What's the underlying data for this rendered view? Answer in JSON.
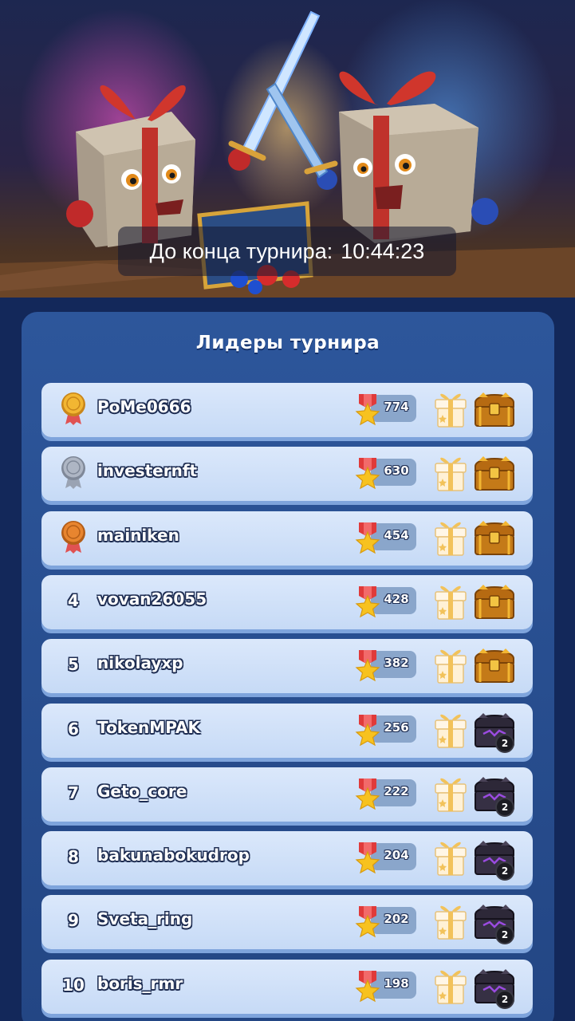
{
  "banner": {
    "timer_label": "До конца турнира:",
    "timer_value": "10:44:23"
  },
  "leaderboard": {
    "title": "Лидеры турнира",
    "rows": [
      {
        "rank": "1",
        "medal": "gold",
        "name": "PoMe0666",
        "score": "774",
        "chest": "gold",
        "chest_count": ""
      },
      {
        "rank": "2",
        "medal": "silver",
        "name": "investernft",
        "score": "630",
        "chest": "gold",
        "chest_count": ""
      },
      {
        "rank": "3",
        "medal": "bronze",
        "name": "mainiken",
        "score": "454",
        "chest": "gold",
        "chest_count": ""
      },
      {
        "rank": "4",
        "medal": "",
        "name": "vovan26055",
        "score": "428",
        "chest": "gold",
        "chest_count": ""
      },
      {
        "rank": "5",
        "medal": "",
        "name": "nikolayxp",
        "score": "382",
        "chest": "gold",
        "chest_count": ""
      },
      {
        "rank": "6",
        "medal": "",
        "name": "TokenMPAK",
        "score": "256",
        "chest": "dark",
        "chest_count": "2"
      },
      {
        "rank": "7",
        "medal": "",
        "name": "Geto_core",
        "score": "222",
        "chest": "dark",
        "chest_count": "2"
      },
      {
        "rank": "8",
        "medal": "",
        "name": "bakunabokudrop",
        "score": "204",
        "chest": "dark",
        "chest_count": "2"
      },
      {
        "rank": "9",
        "medal": "",
        "name": "Sveta_ring",
        "score": "202",
        "chest": "dark",
        "chest_count": "2"
      },
      {
        "rank": "10",
        "medal": "",
        "name": "boris_rmr",
        "score": "198",
        "chest": "dark",
        "chest_count": "2"
      }
    ]
  },
  "colors": {
    "background": "#13285a",
    "panel": "#2a5193",
    "row": "#d3e3f8",
    "gold_medal": "#f2b632",
    "silver_medal": "#aeb6c4",
    "bronze_medal": "#e8852f"
  }
}
